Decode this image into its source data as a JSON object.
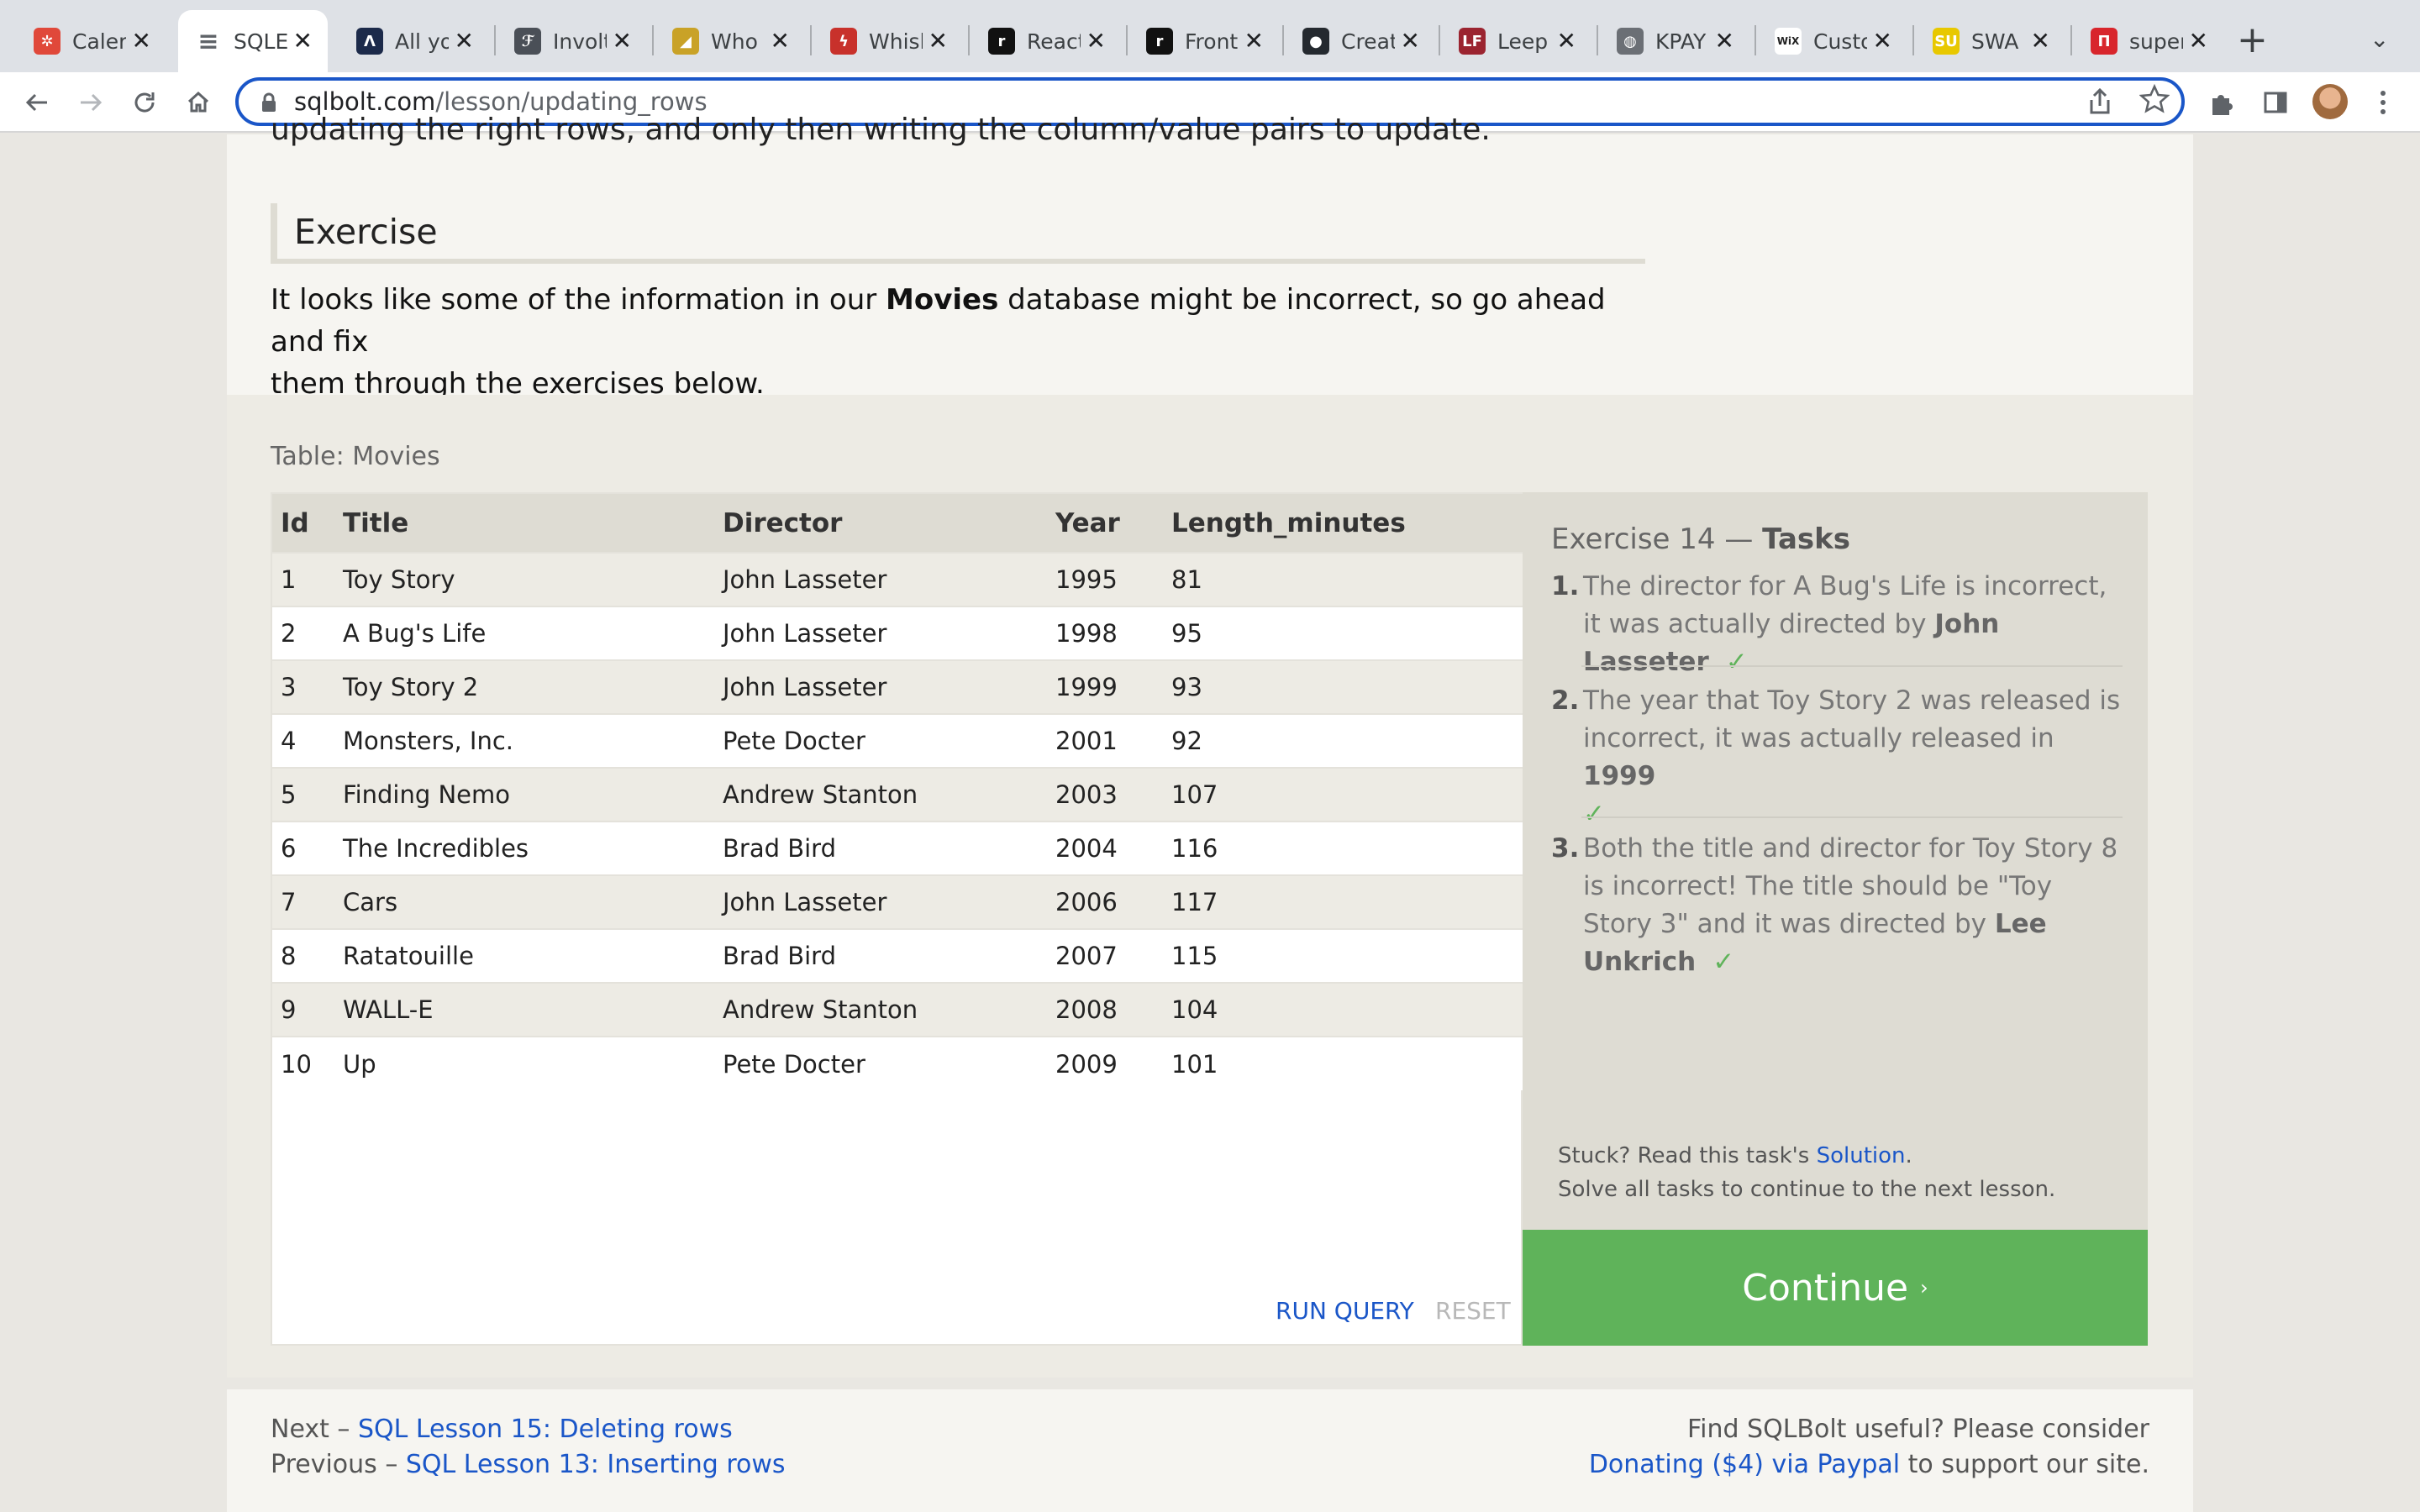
{
  "browser": {
    "tabs": [
      {
        "title": "Caler",
        "icon": "calendar-icon",
        "color": "#e0483a",
        "glyph": "✲"
      },
      {
        "title": "SQLE",
        "icon": "database-icon",
        "color": "#5f6368",
        "glyph": "≡",
        "active": true
      },
      {
        "title": "All yo",
        "icon": "app-icon",
        "color": "#1c2a4a",
        "glyph": "Λ"
      },
      {
        "title": "Involt",
        "icon": "feather-icon",
        "color": "#4a4f57",
        "glyph": "ℱ"
      },
      {
        "title": "Who",
        "icon": "horn-icon",
        "color": "#c9a227",
        "glyph": "◢"
      },
      {
        "title": "Whisl",
        "icon": "bolt-icon",
        "color": "#c8312b",
        "glyph": "ϟ"
      },
      {
        "title": "React",
        "icon": "r-icon",
        "color": "#111111",
        "glyph": "r"
      },
      {
        "title": "Front",
        "icon": "r-icon",
        "color": "#111111",
        "glyph": "r"
      },
      {
        "title": "Creat",
        "icon": "github-icon",
        "color": "#24292f",
        "glyph": "●"
      },
      {
        "title": "Leep",
        "icon": "lf-icon",
        "color": "#9b2430",
        "glyph": "LF"
      },
      {
        "title": "KPAY",
        "icon": "globe-icon",
        "color": "#6b6f75",
        "glyph": "◍"
      },
      {
        "title": "Custo",
        "icon": "wix-icon",
        "color": "#ffffff",
        "glyph": "WiX"
      },
      {
        "title": "SWA",
        "icon": "swa-icon",
        "color": "#e8c800",
        "glyph": "SU"
      },
      {
        "title": "super",
        "icon": "n-icon",
        "color": "#d8252c",
        "glyph": "Π"
      }
    ],
    "new_tab_label": "+",
    "tab_list_label": "⌄",
    "url_host": "sqlbolt.com",
    "url_path": "/lesson/updating_rows"
  },
  "page": {
    "cut_line": "updating the right rows, and only then writing the column/value pairs to update.",
    "exercise_heading": "Exercise",
    "intro_before": "It looks like some of the information in our ",
    "intro_bold": "Movies",
    "intro_after": " database might be incorrect, so go ahead and fix",
    "intro_line2": "them through the exercises below.",
    "table_caption": "Table: Movies",
    "table": {
      "columns": [
        "Id",
        "Title",
        "Director",
        "Year",
        "Length_minutes"
      ],
      "rows": [
        [
          "1",
          "Toy Story",
          "John Lasseter",
          "1995",
          "81"
        ],
        [
          "2",
          "A Bug's Life",
          "John Lasseter",
          "1998",
          "95"
        ],
        [
          "3",
          "Toy Story 2",
          "John Lasseter",
          "1999",
          "93"
        ],
        [
          "4",
          "Monsters, Inc.",
          "Pete Docter",
          "2001",
          "92"
        ],
        [
          "5",
          "Finding Nemo",
          "Andrew Stanton",
          "2003",
          "107"
        ],
        [
          "6",
          "The Incredibles",
          "Brad Bird",
          "2004",
          "116"
        ],
        [
          "7",
          "Cars",
          "John Lasseter",
          "2006",
          "117"
        ],
        [
          "8",
          "Ratatouille",
          "Brad Bird",
          "2007",
          "115"
        ],
        [
          "9",
          "WALL-E",
          "Andrew Stanton",
          "2008",
          "104"
        ],
        [
          "10",
          "Up",
          "Pete Docter",
          "2009",
          "101"
        ]
      ]
    },
    "run_query_label": "RUN QUERY",
    "reset_label": "RESET",
    "tasks": {
      "heading_prefix": "Exercise 14 — ",
      "heading_em": "Tasks",
      "items": [
        {
          "num": "1.",
          "text": "The director for A Bug's Life is incorrect, it was actually directed by ",
          "bold": "John Lasseter",
          "check": "✓"
        },
        {
          "num": "2.",
          "text": "The year that Toy Story 2 was released is incorrect, it was actually released in ",
          "bold": "1999",
          "check": "✓"
        },
        {
          "num": "3.",
          "text": "Both the title and director for Toy Story 8 is incorrect! The title should be \"Toy Story 3\" and it was directed by ",
          "bold": "Lee Unkrich",
          "check": "✓"
        }
      ],
      "stuck_prefix": "Stuck? Read this task's ",
      "stuck_link": "Solution",
      "stuck_suffix": ".",
      "stuck_line2": "Solve all tasks to continue to the next lesson."
    },
    "continue_label": "Continue",
    "continue_chevron": "›",
    "footer": {
      "next_prefix": "Next – ",
      "next_link": "SQL Lesson 15: Deleting rows",
      "prev_prefix": "Previous – ",
      "prev_link": "SQL Lesson 13: Inserting rows",
      "donate_line1": "Find SQLBolt useful? Please consider",
      "donate_link": "Donating ($4) via Paypal",
      "donate_suffix": " to support our site."
    }
  }
}
